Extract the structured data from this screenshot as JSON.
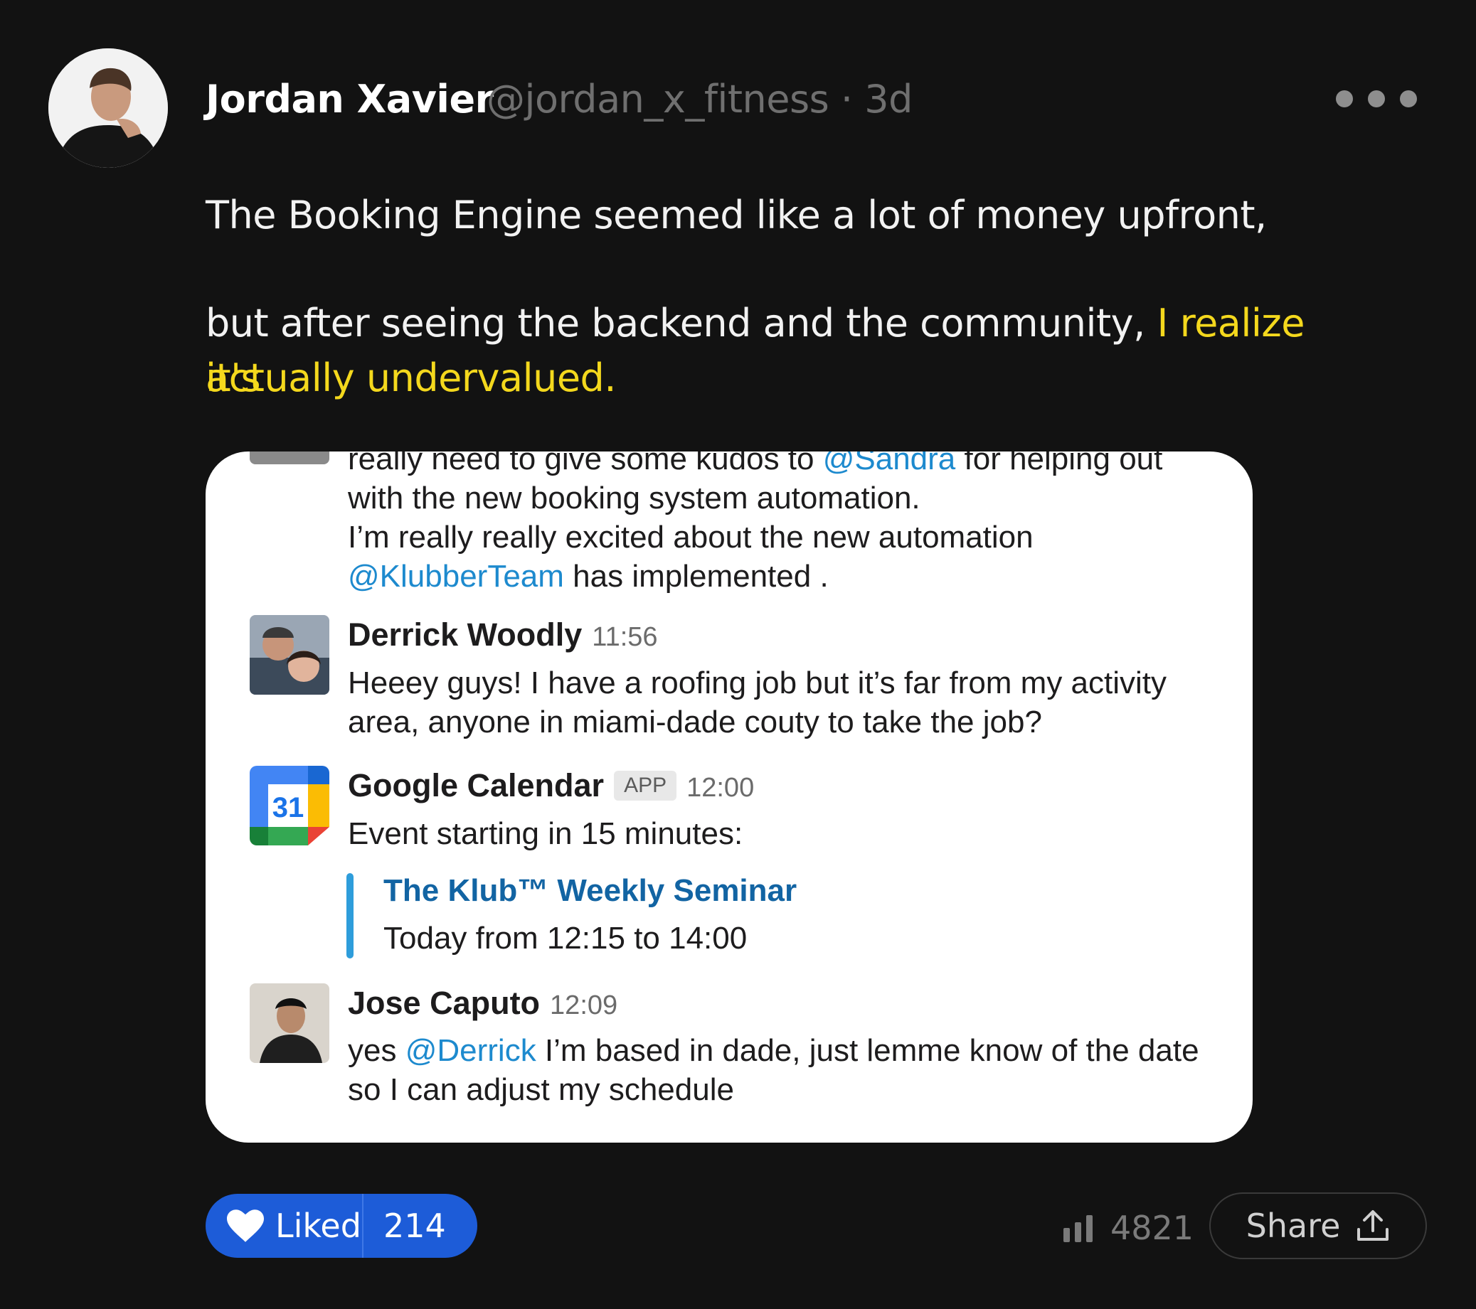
{
  "post": {
    "author_name": "Jordan Xavier",
    "handle_time": "@jordan_x_fitness · 3d",
    "line1": "The Booking Engine seemed like a lot of money upfront,",
    "line2_plain": "but after seeing the backend and the community,",
    "line2_highlight": " I realize it's",
    "line3_highlight": "actually undervalued."
  },
  "chat": {
    "m1_line0_a": "really need to give some kudos to ",
    "m1_mention_sandra": "@Sandra",
    "m1_line0_b": " for helping out",
    "m1_line1": "with the new booking system automation.",
    "m1_line2": "I’m really really excited about the new automation",
    "m1_mention_klubber": "@KlubberTeam",
    "m1_line3_b": " has implemented .",
    "m2_name": "Derrick Woodly",
    "m2_time": "11:56",
    "m2_line1": "Heeey guys! I have a roofing job but it’s far from my activity",
    "m2_line2": "area, anyone in miami-dade couty to take the job?",
    "m3_name": "Google Calendar",
    "m3_badge": "APP",
    "m3_time": "12:00",
    "m3_icon_number": "31",
    "m3_text": "Event starting in 15 minutes:",
    "m3_event_title": "The Klub™ Weekly Seminar",
    "m3_event_time": "Today from 12:15 to 14:00",
    "m4_name": "Jose Caputo",
    "m4_time": "12:09",
    "m4_line1_a": "yes ",
    "m4_mention": "@Derrick",
    "m4_line1_b": " I’m based in dade, just lemme know of the date",
    "m4_line2": "so I can adjust my schedule"
  },
  "actions": {
    "liked_label": "Liked",
    "like_count": "214",
    "views_count": "4821",
    "share_label": "Share"
  },
  "colors": {
    "background": "#121212",
    "highlight": "#f4d81d",
    "liked_button": "#1d5cd8",
    "mention": "#1d8ace",
    "event_title": "#1264a3",
    "event_bar": "#2e9ddb"
  }
}
